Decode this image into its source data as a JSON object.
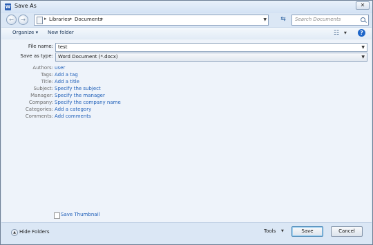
{
  "window": {
    "title": "Save As",
    "app_icon_letter": "W",
    "close_label": "✕"
  },
  "nav": {
    "back_glyph": "←",
    "forward_glyph": "→",
    "crumb_sep": "▸",
    "crumbs": [
      "Libraries",
      "Documents"
    ],
    "search_placeholder": "Search Documents"
  },
  "toolbar": {
    "organize": "Organize",
    "new_folder": "New folder"
  },
  "form": {
    "filename_label": "File name:",
    "filename_value": "test",
    "savetype_label": "Save as type:",
    "savetype_value": "Word Document (*.docx)"
  },
  "meta": [
    {
      "label": "Authors:",
      "value": "user"
    },
    {
      "label": "Tags:",
      "value": "Add a tag"
    },
    {
      "label": "Title:",
      "value": "Add a title"
    },
    {
      "label": "Subject:",
      "value": "Specify the subject"
    },
    {
      "label": "Manager:",
      "value": "Specify the manager"
    },
    {
      "label": "Company:",
      "value": "Specify the company name"
    },
    {
      "label": "Categories:",
      "value": "Add a category"
    },
    {
      "label": "Comments:",
      "value": "Add comments"
    }
  ],
  "thumbnail_label": "Save Thumbnail",
  "bottom": {
    "hide_folders": "Hide Folders",
    "tools": "Tools",
    "save": "Save",
    "cancel": "Cancel"
  }
}
